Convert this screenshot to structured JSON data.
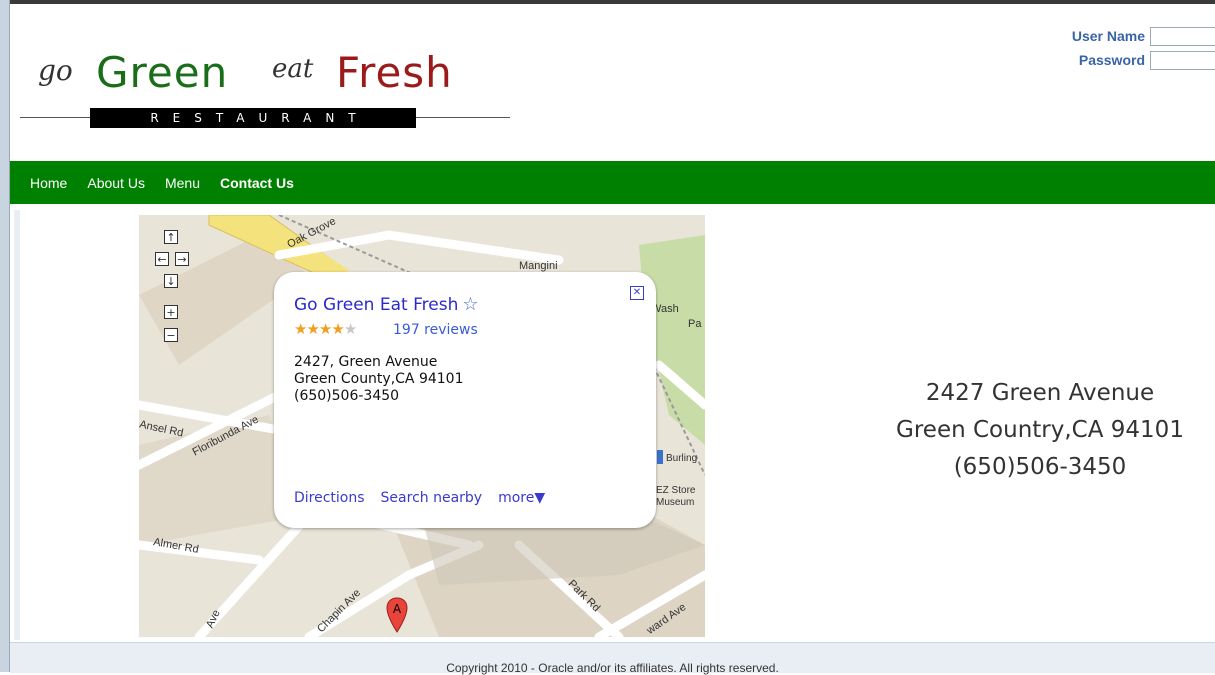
{
  "brand": {
    "go": "go",
    "green": "Green",
    "eat": "eat",
    "fresh": "Fresh",
    "tagline": "RESTAURANT",
    "green_color": "#1a6e1a",
    "fresh_color": "#9b1b1b"
  },
  "login": {
    "username_label": "User Name",
    "password_label": "Password",
    "username_value": "",
    "password_value": ""
  },
  "nav": {
    "items": [
      {
        "label": "Home",
        "active": false
      },
      {
        "label": "About Us",
        "active": false
      },
      {
        "label": "Menu",
        "active": false
      },
      {
        "label": "Contact Us",
        "active": true
      }
    ],
    "background": "#008000"
  },
  "map": {
    "controls": [
      "arrow-up-icon",
      "arrow-left-icon",
      "arrow-right-icon",
      "arrow-down-icon",
      "zoom-in-icon",
      "zoom-out-icon"
    ],
    "roads": {
      "oak_grove": "Oak Grove",
      "mangini": "Mangini",
      "ansel": "Ansel Rd",
      "floribunda": "Floribunda Ave",
      "almer": "Almer Rd",
      "chapin": "Chapin Ave",
      "park": "Park Rd",
      "ward": "ward Ave",
      "ave_sw": "Ave",
      "ave_sw2": "Ave",
      "wash": "Wash",
      "pa": "Pa",
      "burling": "Burling",
      "ez_store": "EZ Store",
      "museum": "Museum"
    },
    "marker_label": "A",
    "info_window": {
      "title": "Go Green Eat Fresh",
      "rating_filled": 4,
      "rating_total": 5,
      "reviews": "197 reviews",
      "address_line1": "2427, Green Avenue",
      "address_line2": "Green County,CA 94101",
      "phone": "(650)506-3450",
      "links": {
        "directions": "Directions",
        "search_nearby": "Search nearby",
        "more": "more▼"
      },
      "close_glyph": "✕"
    }
  },
  "contact": {
    "line1": "2427 Green Avenue",
    "line2": "Green Country,CA 94101",
    "line3": "(650)506-3450"
  },
  "footer": {
    "text": "Copyright 2010 - Oracle and/or its affiliates. All rights reserved."
  }
}
